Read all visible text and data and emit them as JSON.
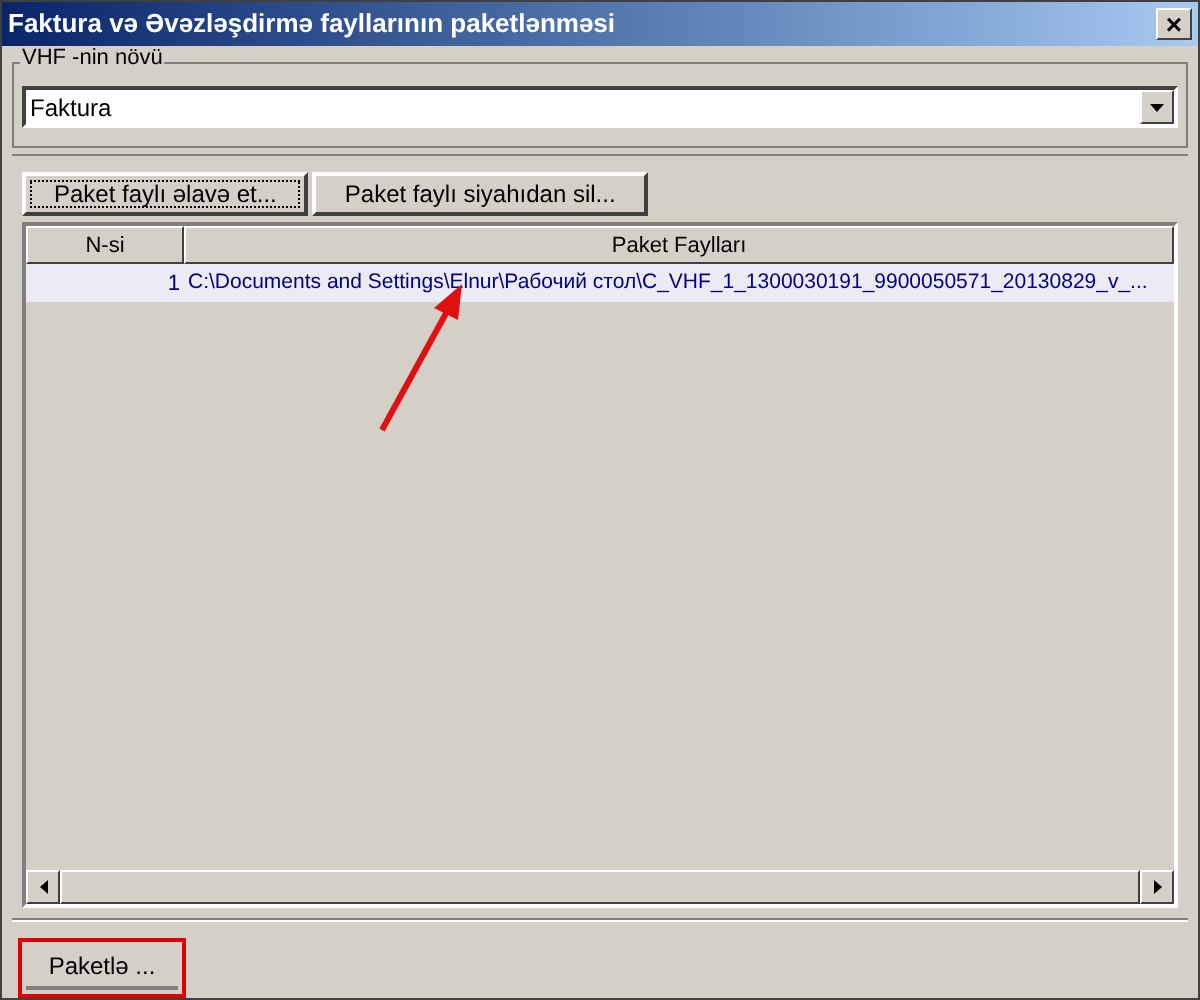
{
  "window": {
    "title": "Faktura və Əvəzləşdirmə fayllarının paketlənməsi",
    "close": "×"
  },
  "type_group": {
    "label": "VHF -nin növü",
    "value": "Faktura"
  },
  "buttons": [
    {
      "label": "Paket faylı əlavə et...",
      "focused": true
    },
    {
      "label": "Paket faylı siyahıdan sil...",
      "focused": false
    }
  ],
  "table": {
    "columns": [
      "N-si",
      "Paket Faylları"
    ],
    "rows": [
      {
        "number": "1",
        "path": "C:\\Documents and Settings\\Elnur\\Рабочий стол\\C_VHF_1_1300030191_9900050571_20130829_v_...",
        "selected": true
      }
    ]
  },
  "footer": {
    "button": "Paketlə ...",
    "highlighted": true
  }
}
